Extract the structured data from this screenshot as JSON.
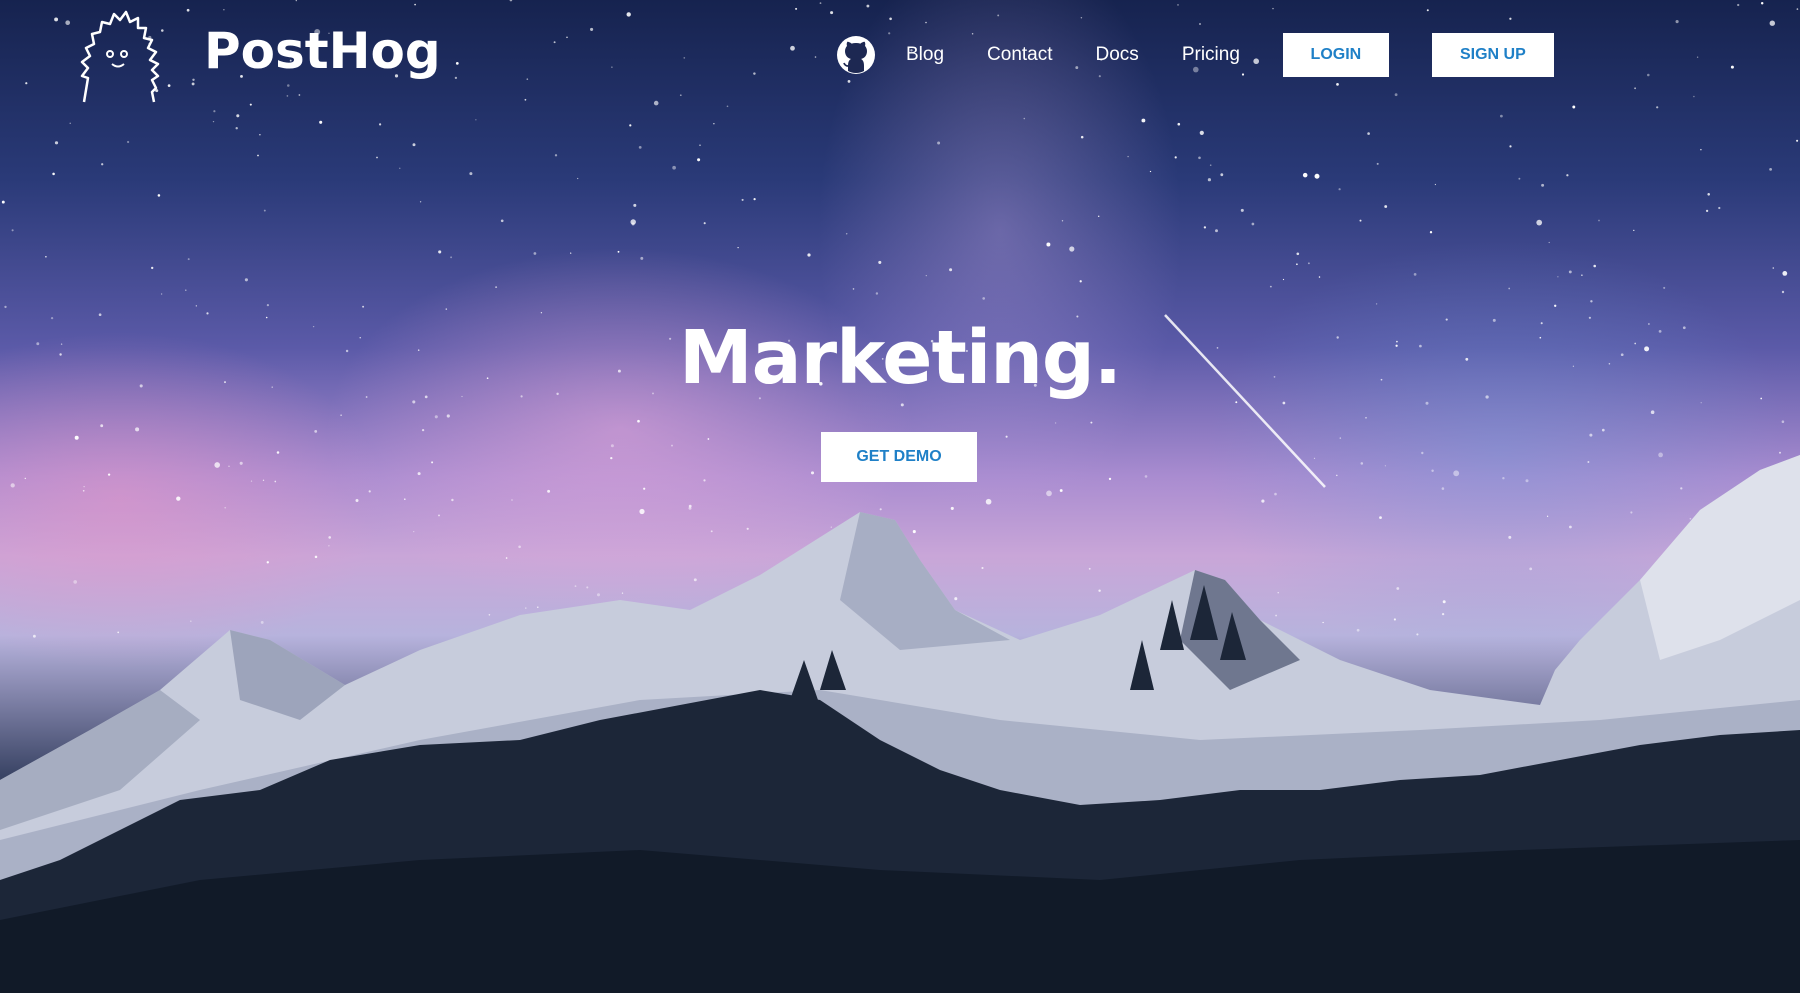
{
  "brand": {
    "name": "PostHog",
    "logo_icon": "hedgehog-logo-icon"
  },
  "nav": {
    "github_icon": "github-icon",
    "links": [
      "Blog",
      "Contact",
      "Docs",
      "Pricing"
    ],
    "login_label": "LOGIN",
    "signup_label": "SIGN UP"
  },
  "hero": {
    "title": "Marketing.",
    "cta_label": "GET DEMO"
  },
  "colors": {
    "accent": "#1f80c7",
    "button_bg": "#ffffff",
    "text": "#ffffff"
  }
}
